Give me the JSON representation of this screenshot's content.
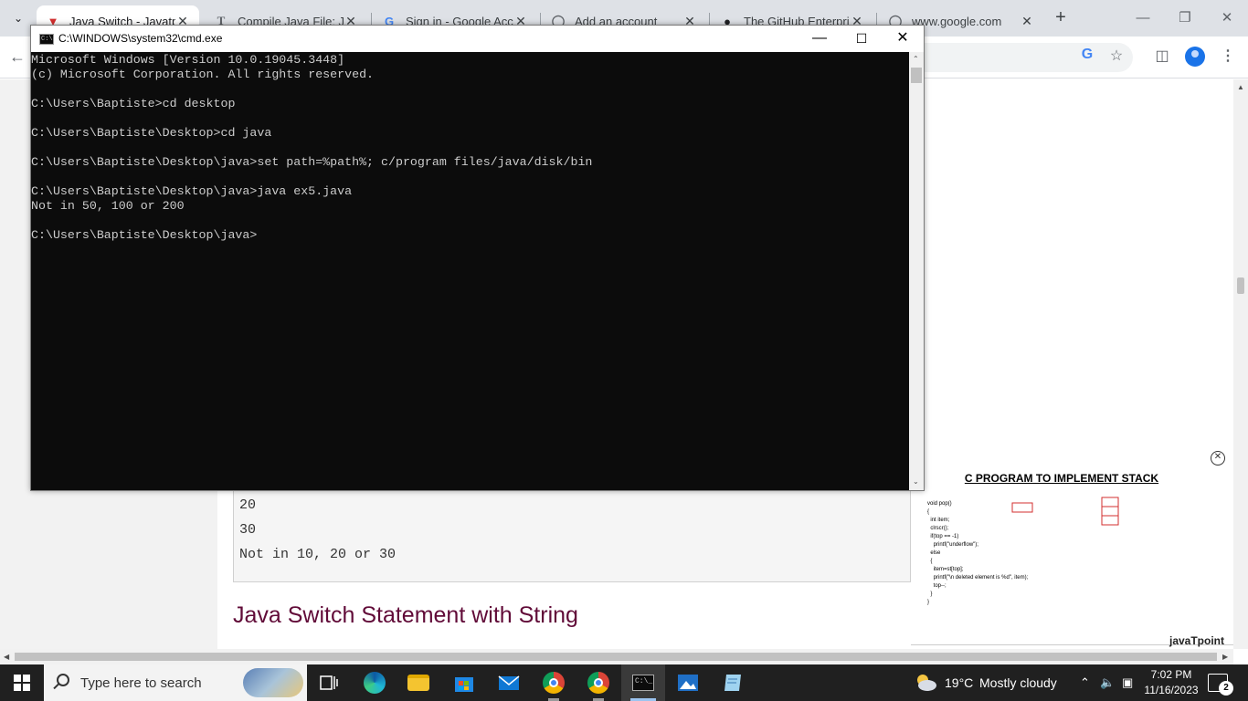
{
  "browser": {
    "tabs": [
      {
        "title": "Java Switch - Javatpo",
        "favicon": "javatpoint-icon",
        "active": true
      },
      {
        "title": "Compile Java File: Jav",
        "favicon": "t-icon",
        "active": false
      },
      {
        "title": "Sign in - Google Acco",
        "favicon": "google-icon",
        "active": false
      },
      {
        "title": "Add an account",
        "favicon": "github-circle-icon",
        "active": false
      },
      {
        "title": "The GitHub Enterpris",
        "favicon": "github-icon",
        "active": false
      },
      {
        "title": "www.google.com",
        "favicon": "globe-icon",
        "active": false
      }
    ],
    "new_tab_label": "+",
    "close_glyph": "✕"
  },
  "page": {
    "code_output": [
      "20",
      "30",
      "Not in 10, 20 or 30"
    ],
    "section_heading": "Java Switch Statement with String",
    "ad": {
      "title": "C PROGRAM TO IMPLEMENT STACK",
      "code_snippet": "void pop()\n{\n  int item;\n  clrscr();\n  if(top == -1)\n    printf(\"underflow\");\n  else\n  {\n    item=st[top];\n    printf(\"\\n deleted element is %d\", item);\n    top--;\n  }\n}",
      "logo": "javaTpoint"
    }
  },
  "cmd": {
    "title": "C:\\WINDOWS\\system32\\cmd.exe",
    "lines": [
      "Microsoft Windows [Version 10.0.19045.3448]",
      "(c) Microsoft Corporation. All rights reserved.",
      "",
      "C:\\Users\\Baptiste>cd desktop",
      "",
      "C:\\Users\\Baptiste\\Desktop>cd java",
      "",
      "C:\\Users\\Baptiste\\Desktop\\java>set path=%path%; c/program files/java/disk/bin",
      "",
      "C:\\Users\\Baptiste\\Desktop\\java>java ex5.java",
      "Not in 50, 100 or 200",
      "",
      "C:\\Users\\Baptiste\\Desktop\\java>"
    ]
  },
  "taskbar": {
    "search_placeholder": "Type here to search",
    "weather_temp": "19°C",
    "weather_desc": "Mostly cloudy",
    "time": "7:02 PM",
    "date": "11/16/2023",
    "notification_count": "2"
  }
}
